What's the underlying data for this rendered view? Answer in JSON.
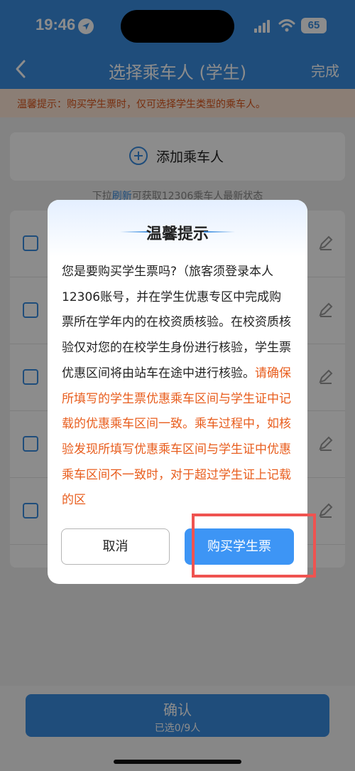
{
  "status_bar": {
    "time": "19:46",
    "battery": "65"
  },
  "nav": {
    "title": "选择乘车人 (学生)",
    "done": "完成"
  },
  "notice": "温馨提示：购买学生票时，仅可选择学生类型的乘车人。",
  "add_passenger": "添加乘车人",
  "refresh_tip": {
    "prefix": "下拉",
    "link": "刷新",
    "suffix": "可获取12306乘车人最新状态"
  },
  "bottom": {
    "confirm": "确认",
    "selected": "已选0/9人"
  },
  "dialog": {
    "title": "温馨提示",
    "body_normal": "您是要购买学生票吗?（旅客须登录本人12306账号，并在学生优惠专区中完成购票所在学年内的在校资质核验。在校资质核验仅对您的在校学生身份进行核验，学生票优惠区间将由站车在途中进行核验。",
    "body_warning": "请确保所填写的学生票优惠乘车区间与学生证中记载的优惠乘车区间一致。乘车过程中，如核验发现所填写优惠乘车区间与学生证中优惠乘车区间不一致时，对于超过学生证上记载的区",
    "cancel": "取消",
    "buy": "购买学生票"
  },
  "colors": {
    "primary": "#3a8de0",
    "warning": "#e85d1d",
    "highlight": "#ef5350"
  }
}
